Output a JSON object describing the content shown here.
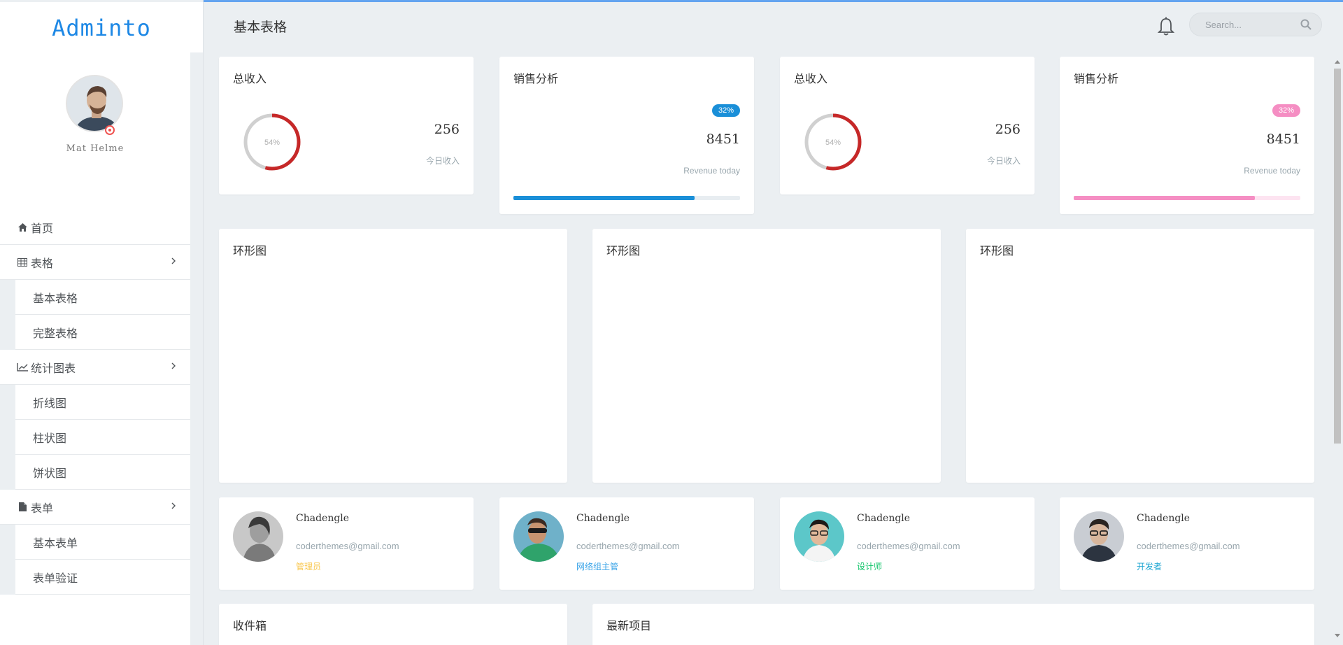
{
  "app": {
    "logo": "Adminto"
  },
  "user": {
    "name": "Mat Helme"
  },
  "menu": [
    {
      "label": "首页",
      "icon": "home-icon",
      "children": []
    },
    {
      "label": "表格",
      "icon": "table-icon",
      "children": [
        "基本表格",
        "完整表格"
      ]
    },
    {
      "label": "统计图表",
      "icon": "line-chart-icon",
      "children": [
        "折线图",
        "柱状图",
        "饼状图"
      ]
    },
    {
      "label": "表单",
      "icon": "file-icon",
      "children": [
        "基本表单",
        "表单验证"
      ]
    }
  ],
  "header": {
    "title": "基本表格",
    "search_placeholder": "Search..."
  },
  "stats": [
    {
      "title": "总收入",
      "percent_label": "54%",
      "percent": 54,
      "value": "256",
      "label": "今日收入"
    },
    {
      "title": "销售分析",
      "badge": "32%",
      "value": "8451",
      "label": "Revenue today",
      "progress": 80,
      "color": "#1a8fd8"
    },
    {
      "title": "总收入",
      "percent_label": "54%",
      "percent": 54,
      "value": "256",
      "label": "今日收入"
    },
    {
      "title": "销售分析",
      "badge": "32%",
      "value": "8451",
      "label": "Revenue today",
      "progress": 80,
      "color": "#f58ec3"
    }
  ],
  "charts": [
    {
      "title": "环形图"
    },
    {
      "title": "环形图"
    },
    {
      "title": "环形图"
    }
  ],
  "users": [
    {
      "name": "Chadengle",
      "email": "coderthemes@gmail.com",
      "role": "管理员",
      "role_color": "#f9c851"
    },
    {
      "name": "Chadengle",
      "email": "coderthemes@gmail.com",
      "role": "网络组主管",
      "role_color": "#3ea6e8"
    },
    {
      "name": "Chadengle",
      "email": "coderthemes@gmail.com",
      "role": "设计师",
      "role_color": "#10c469"
    },
    {
      "name": "Chadengle",
      "email": "coderthemes@gmail.com",
      "role": "开发者",
      "role_color": "#1ba4d1"
    }
  ],
  "bottom": {
    "inbox_title": "收件箱",
    "projects_title": "最新项目"
  },
  "colors": {
    "accent": "#1e88e5",
    "donut": "#c62828"
  }
}
